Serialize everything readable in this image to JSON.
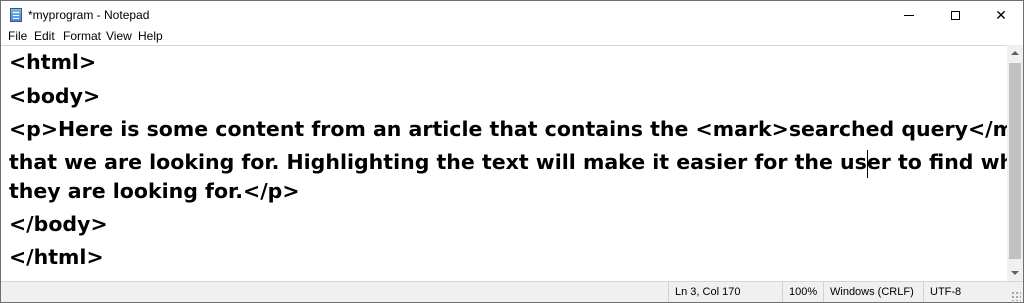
{
  "window": {
    "title": "*myprogram - Notepad",
    "icon": "notepad-icon",
    "controls": {
      "minimize": "minimize-icon",
      "maximize": "maximize-icon",
      "close": "close-icon",
      "close_glyph": "✕"
    }
  },
  "menu": {
    "items": [
      {
        "label": "File"
      },
      {
        "label": "Edit"
      },
      {
        "label": "Format"
      },
      {
        "label": "View"
      },
      {
        "label": "Help"
      }
    ]
  },
  "editor": {
    "lines": [
      "<html>",
      "<body>",
      "<p>Here is some content from an article that contains the <mark>searched query</mark>",
      "that we are looking for. Highlighting the text will make it easier for the user to find what",
      "they are looking for.</p>",
      "</body>",
      "</html>"
    ]
  },
  "status": {
    "position": "Ln 3, Col 170",
    "zoom": "100%",
    "line_ending": "Windows (CRLF)",
    "encoding": "UTF-8"
  }
}
